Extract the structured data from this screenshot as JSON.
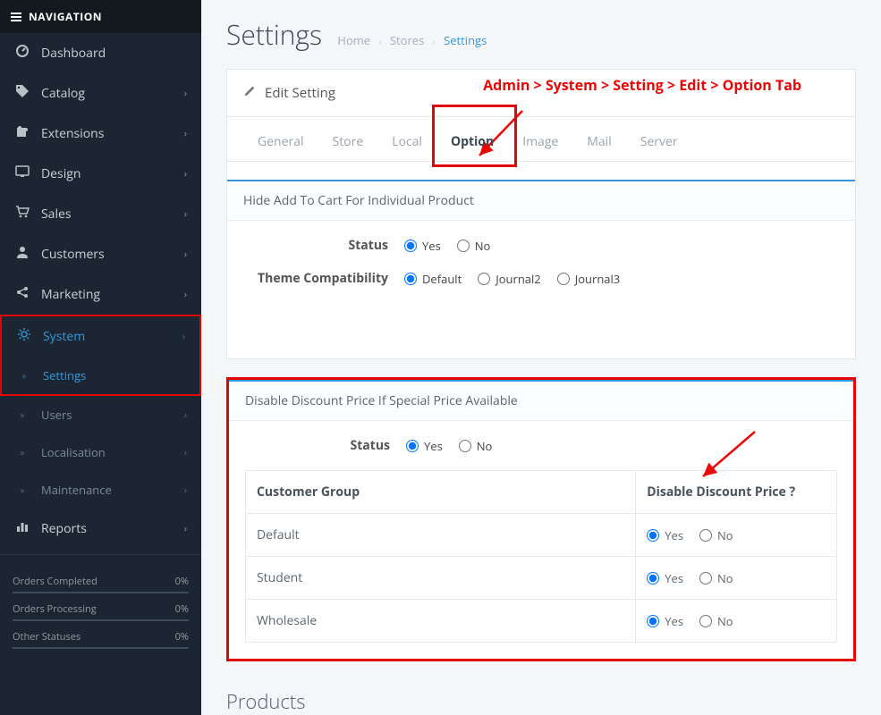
{
  "nav": {
    "header": "NAVIGATION",
    "items": [
      {
        "icon": "dashboard-icon",
        "glyph": "◉",
        "label": "Dashboard",
        "expandable": false
      },
      {
        "icon": "tag-icon",
        "glyph": "🏷",
        "label": "Catalog",
        "expandable": true
      },
      {
        "icon": "puzzle-icon",
        "glyph": "✚",
        "label": "Extensions",
        "expandable": true
      },
      {
        "icon": "monitor-icon",
        "glyph": "🖵",
        "label": "Design",
        "expandable": true
      },
      {
        "icon": "cart-icon",
        "glyph": "🛒",
        "label": "Sales",
        "expandable": true
      },
      {
        "icon": "user-icon",
        "glyph": "👤",
        "label": "Customers",
        "expandable": true
      },
      {
        "icon": "share-icon",
        "glyph": "◀",
        "label": "Marketing",
        "expandable": true
      },
      {
        "icon": "gear-icon",
        "glyph": "⚙",
        "label": "System",
        "expandable": true,
        "active": true
      }
    ],
    "systemSub": [
      {
        "label": "Settings",
        "active": true
      },
      {
        "label": "Users",
        "expandable": true
      },
      {
        "label": "Localisation",
        "expandable": true
      },
      {
        "label": "Maintenance",
        "expandable": true
      }
    ],
    "reports": {
      "glyph": "📊",
      "label": "Reports"
    },
    "stats": [
      {
        "label": "Orders Completed",
        "value": "0%"
      },
      {
        "label": "Orders Processing",
        "value": "0%"
      },
      {
        "label": "Other Statuses",
        "value": "0%"
      }
    ]
  },
  "page": {
    "title": "Settings",
    "breadcrumb": {
      "home": "Home",
      "stores": "Stores",
      "current": "Settings"
    }
  },
  "panel": {
    "title": "Edit Setting",
    "annotation": "Admin > System > Setting > Edit > Option Tab",
    "tabs": [
      "General",
      "Store",
      "Local",
      "Option",
      "Image",
      "Mail",
      "Server"
    ],
    "activeTabIndex": 3
  },
  "module1": {
    "title": "Hide Add To Cart For Individual Product",
    "statusLabel": "Status",
    "yes": "Yes",
    "no": "No",
    "compatLabel": "Theme Compatibility",
    "compatOptions": [
      "Default",
      "Journal2",
      "Journal3"
    ]
  },
  "module2": {
    "title": "Disable Discount Price If Special Price Available",
    "statusLabel": "Status",
    "yes": "Yes",
    "no": "No",
    "tableHeaders": {
      "group": "Customer Group",
      "disable": "Disable Discount Price ?"
    },
    "rows": [
      {
        "group": "Default"
      },
      {
        "group": "Student"
      },
      {
        "group": "Wholesale"
      }
    ]
  },
  "sectionHeading": "Products"
}
